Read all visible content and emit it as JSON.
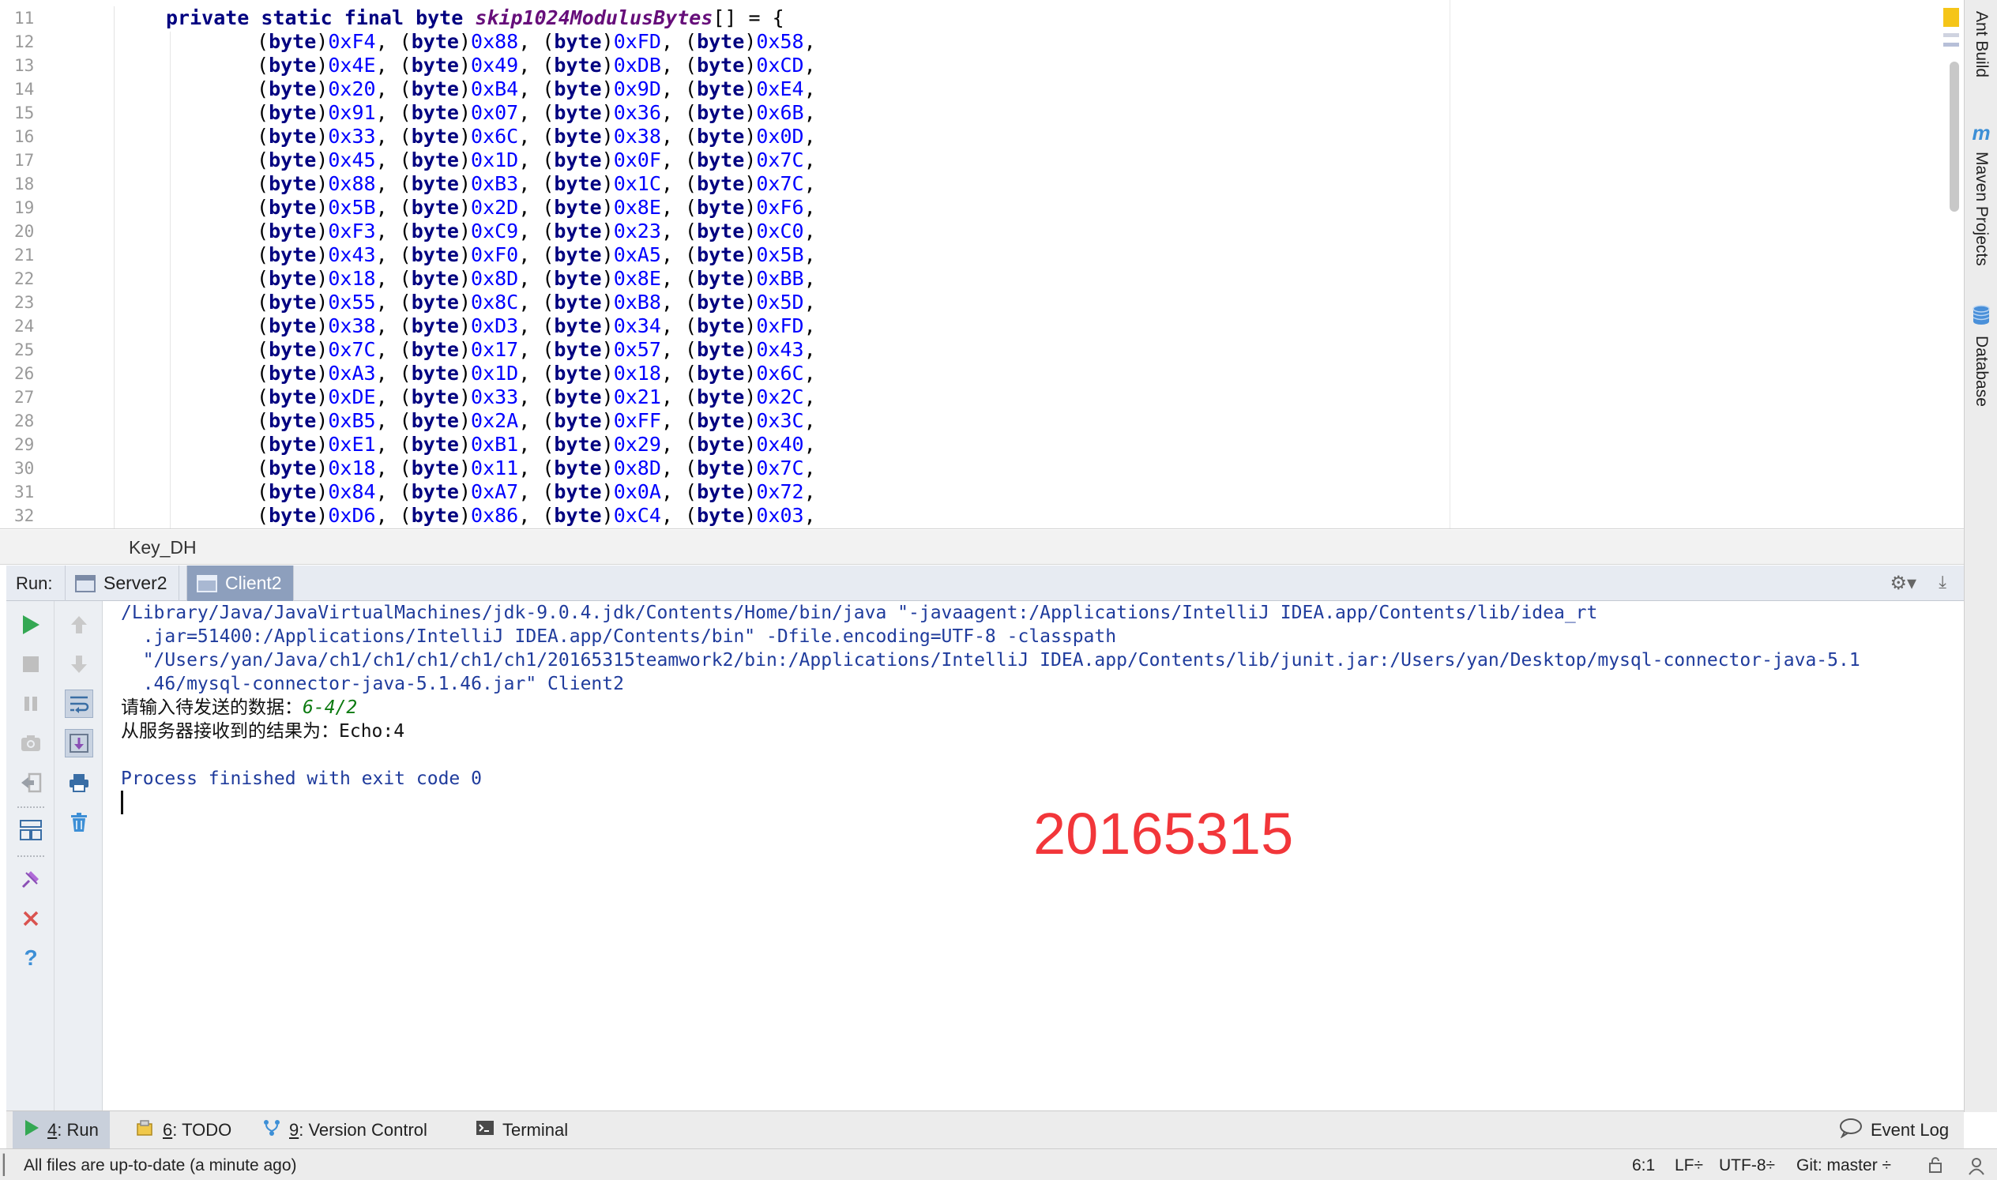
{
  "editor": {
    "line_numbers": [
      "11",
      "12",
      "13",
      "14",
      "15",
      "16",
      "17",
      "18",
      "19",
      "20",
      "21",
      "22",
      "23",
      "24",
      "25",
      "26",
      "27",
      "28",
      "29",
      "30",
      "31",
      "32"
    ],
    "decl": {
      "modifiers": "private static final byte ",
      "name": "skip1024ModulusBytes",
      "suffix": "[] = {"
    },
    "cast": "(byte)",
    "rows": [
      [
        "0xF4",
        "0x88",
        "0xFD",
        "0x58"
      ],
      [
        "0x4E",
        "0x49",
        "0xDB",
        "0xCD"
      ],
      [
        "0x20",
        "0xB4",
        "0x9D",
        "0xE4"
      ],
      [
        "0x91",
        "0x07",
        "0x36",
        "0x6B"
      ],
      [
        "0x33",
        "0x6C",
        "0x38",
        "0x0D"
      ],
      [
        "0x45",
        "0x1D",
        "0x0F",
        "0x7C"
      ],
      [
        "0x88",
        "0xB3",
        "0x1C",
        "0x7C"
      ],
      [
        "0x5B",
        "0x2D",
        "0x8E",
        "0xF6"
      ],
      [
        "0xF3",
        "0xC9",
        "0x23",
        "0xC0"
      ],
      [
        "0x43",
        "0xF0",
        "0xA5",
        "0x5B"
      ],
      [
        "0x18",
        "0x8D",
        "0x8E",
        "0xBB"
      ],
      [
        "0x55",
        "0x8C",
        "0xB8",
        "0x5D"
      ],
      [
        "0x38",
        "0xD3",
        "0x34",
        "0xFD"
      ],
      [
        "0x7C",
        "0x17",
        "0x57",
        "0x43"
      ],
      [
        "0xA3",
        "0x1D",
        "0x18",
        "0x6C"
      ],
      [
        "0xDE",
        "0x33",
        "0x21",
        "0x2C"
      ],
      [
        "0xB5",
        "0x2A",
        "0xFF",
        "0x3C"
      ],
      [
        "0xE1",
        "0xB1",
        "0x29",
        "0x40"
      ],
      [
        "0x18",
        "0x11",
        "0x8D",
        "0x7C"
      ],
      [
        "0x84",
        "0xA7",
        "0x0A",
        "0x72"
      ],
      [
        "0xD6",
        "0x86",
        "0xC4",
        "0x03"
      ]
    ]
  },
  "breadcrumb": {
    "class_name": "Key_DH"
  },
  "run_panel": {
    "label": "Run:",
    "tabs": [
      {
        "label": "Server2",
        "active": false
      },
      {
        "label": "Client2",
        "active": true
      }
    ]
  },
  "console": {
    "command_lines": [
      "/Library/Java/JavaVirtualMachines/jdk-9.0.4.jdk/Contents/Home/bin/java \"-javaagent:/Applications/IntelliJ IDEA.app/Contents/lib/idea_rt",
      "  .jar=51400:/Applications/IntelliJ IDEA.app/Contents/bin\" -Dfile.encoding=UTF-8 -classpath",
      "  \"/Users/yan/Java/ch1/ch1/ch1/ch1/ch1/20165315teamwork2/bin:/Applications/IntelliJ IDEA.app/Contents/lib/junit.jar:/Users/yan/Desktop/mysql-connector-java-5.1",
      "  .46/mysql-connector-java-5.1.46.jar\" Client2"
    ],
    "prompt_text": "请输入待发送的数据：",
    "prompt_input": "6-4/2",
    "result_line": "从服务器接收到的结果为：Echo:4",
    "exit_line": "Process finished with exit code 0"
  },
  "watermark": "20165315",
  "right_tools": [
    {
      "label": "Ant Build",
      "icon": "ant-build-icon"
    },
    {
      "label": "Maven Projects",
      "icon": "maven-icon"
    },
    {
      "label": "Database",
      "icon": "database-icon"
    }
  ],
  "tool_tabs": {
    "run": {
      "num": "4",
      "rest": ": Run"
    },
    "todo": {
      "num": "6",
      "rest": ": TODO"
    },
    "vcs": {
      "num": "9",
      "rest": ": Version Control"
    },
    "terminal": {
      "label": "Terminal"
    },
    "event_log": {
      "label": "Event Log"
    }
  },
  "status_bar": {
    "message": "All files are up-to-date (a minute ago)",
    "position": "6:1",
    "line_sep": "LF",
    "encoding": "UTF-8",
    "git": "Git: master"
  },
  "colors": {
    "keyword": "#000080",
    "hex_literal": "#0000ff",
    "static_field": "#660e7a",
    "console_command": "#1f3b9c",
    "console_input": "#0c7a10",
    "watermark": "#f2363a",
    "run_icon": "#34a853",
    "stop_icon": "#d9534f"
  }
}
